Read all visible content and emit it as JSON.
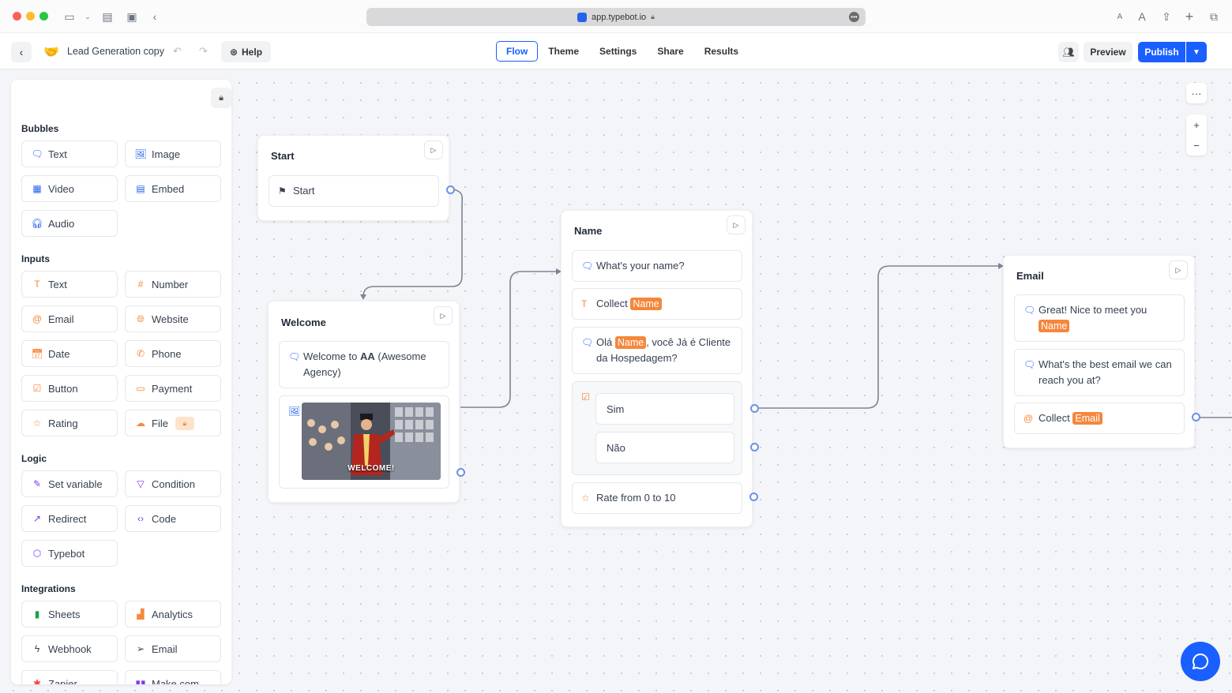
{
  "browser": {
    "url": "app.typebot.io",
    "traffic_colors": [
      "#fe5f57",
      "#febc2e",
      "#28c840"
    ]
  },
  "header": {
    "back_icon": "chevron-left-icon",
    "bot_emoji": "🤝",
    "bot_name": "Lead Generation copy",
    "help_label": "Help",
    "tabs": [
      {
        "label": "Flow",
        "active": true
      },
      {
        "label": "Theme",
        "active": false
      },
      {
        "label": "Settings",
        "active": false
      },
      {
        "label": "Share",
        "active": false
      },
      {
        "label": "Results",
        "active": false
      }
    ],
    "preview_label": "Preview",
    "publish_label": "Publish"
  },
  "sidebar": {
    "sections": [
      {
        "title": "Bubbles",
        "items": [
          "Text",
          "Image",
          "Video",
          "Embed",
          "Audio"
        ]
      },
      {
        "title": "Inputs",
        "items": [
          "Text",
          "Number",
          "Email",
          "Website",
          "Date",
          "Phone",
          "Button",
          "Payment",
          "Rating",
          "File"
        ]
      },
      {
        "title": "Logic",
        "items": [
          "Set variable",
          "Condition",
          "Redirect",
          "Code",
          "Typebot"
        ]
      },
      {
        "title": "Integrations",
        "items": [
          "Sheets",
          "Analytics",
          "Webhook",
          "Email",
          "Zapier",
          "Make.com"
        ]
      }
    ]
  },
  "groups": {
    "start": {
      "title": "Start",
      "step": "Start"
    },
    "welcome": {
      "title": "Welcome",
      "text_pre": "Welcome to ",
      "text_bold": "AA",
      "text_post": " (Awesome Agency)",
      "gif_caption": "WELCOME!"
    },
    "name": {
      "title": "Name",
      "question": "What's your name?",
      "collect_label": "Collect",
      "collect_var": "Name",
      "greet_pre": "Olá",
      "greet_var": "Name",
      "greet_post": ", você Já é Cliente da Hospedagem?",
      "choices": [
        "Sim",
        "Não"
      ],
      "rating": "Rate from 0 to 10"
    },
    "email": {
      "title": "Email",
      "greet": "Great! Nice to meet you",
      "greet_var": "Name",
      "question": "What's the best email we can reach you at?",
      "collect_label": "Collect",
      "collect_var": "Email"
    }
  },
  "colors": {
    "accent": "#1a5fff",
    "variable": "#f5873c",
    "connector": "#7d8594",
    "port": "#6d8fe8"
  }
}
